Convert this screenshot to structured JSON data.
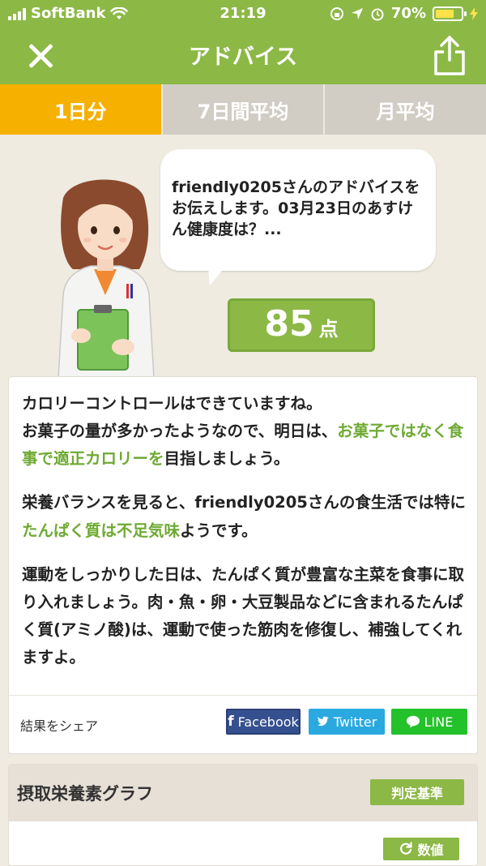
{
  "status": {
    "carrier": "SoftBank",
    "time": "21:19",
    "battery": "70%"
  },
  "header": {
    "title": "アドバイス"
  },
  "tabs": [
    {
      "label": "1日分",
      "active": true
    },
    {
      "label": "7日間平均",
      "active": false
    },
    {
      "label": "月平均",
      "active": false
    }
  ],
  "bubble": {
    "text": "friendly0205さんのアドバイスをお伝えします。03月23日のあすけん健康度は？..."
  },
  "score": {
    "value": "85",
    "unit": "点"
  },
  "advice": {
    "p1_a": "カロリーコントロールはできていますね。",
    "p1_b": "お菓子の量が多かったようなので、明日は、",
    "p1_hl": "お菓子ではなく食事で適正カロリーを",
    "p1_c": "目指しましょう。",
    "p2_a": "栄養バランスを見ると、friendly0205さんの食生活では特に",
    "p2_hl": "たんぱく質は不足気味",
    "p2_b": "ようです。",
    "p3": "運動をしっかりした日は、たんぱく質が豊富な主菜を食事に取り入れましょう。肉・魚・卵・大豆製品などに含まれるたんぱく質(アミノ酸)は、運動で使った筋肉を修復し、補強してくれますよ。"
  },
  "share": {
    "label": "結果をシェア",
    "facebook": "Facebook",
    "twitter": "Twitter",
    "line": "LINE"
  },
  "graph": {
    "title": "摂取栄養素グラフ",
    "criteria_button": "判定基準",
    "value_button": "数値"
  },
  "colors": {
    "brand_green": "#8cb846",
    "tab_active": "#f5b000",
    "highlight": "#6eaa32"
  }
}
